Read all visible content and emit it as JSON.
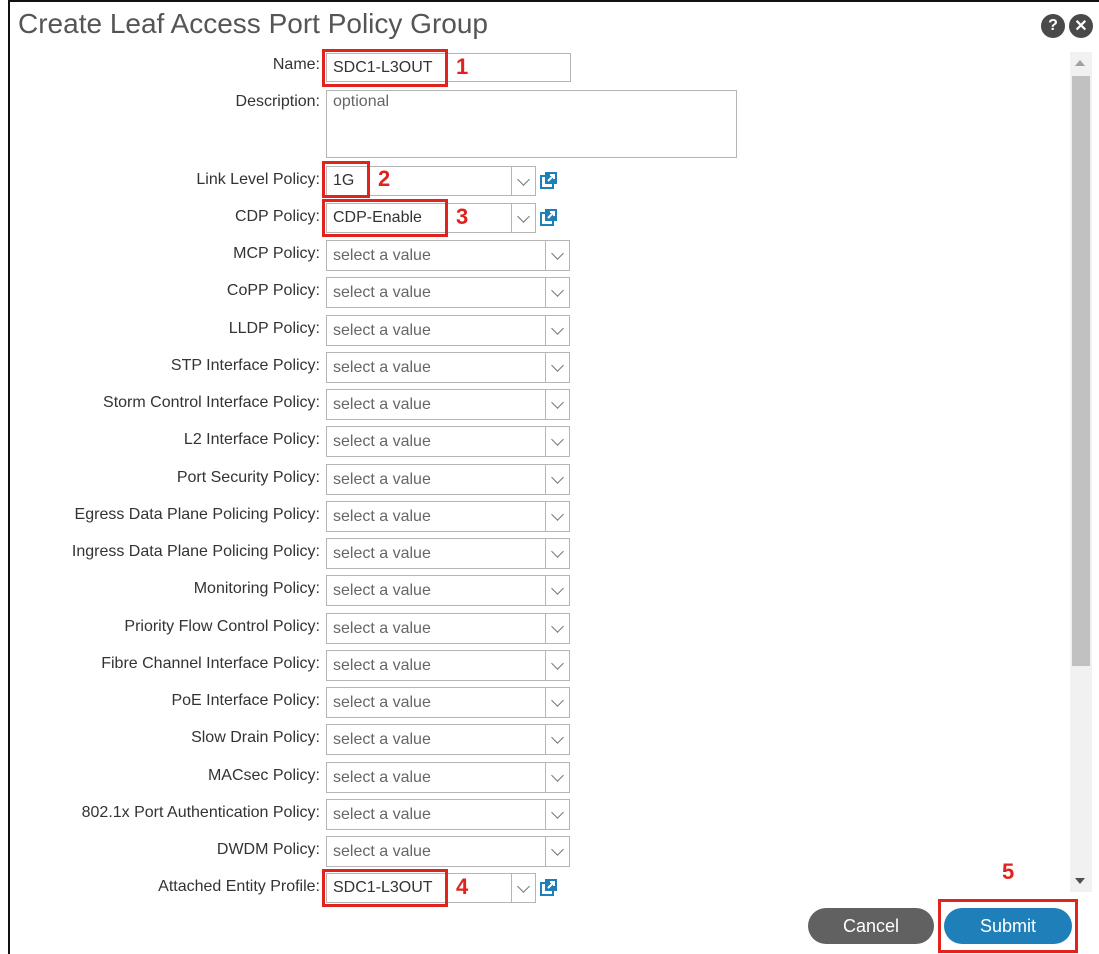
{
  "dialog": {
    "title": "Create Leaf Access Port Policy Group",
    "help_icon": "help-icon",
    "close_icon": "close-icon"
  },
  "fields": {
    "name": {
      "label": "Name:",
      "value": "SDC1-L3OUT"
    },
    "description": {
      "label": "Description:",
      "placeholder": "optional"
    },
    "link_level": {
      "label": "Link Level Policy:",
      "value": "1G"
    },
    "cdp": {
      "label": "CDP Policy:",
      "value": "CDP-Enable"
    },
    "selects": [
      {
        "label": "MCP Policy:",
        "value": "select a value"
      },
      {
        "label": "CoPP Policy:",
        "value": "select a value"
      },
      {
        "label": "LLDP Policy:",
        "value": "select a value"
      },
      {
        "label": "STP Interface Policy:",
        "value": "select a value"
      },
      {
        "label": "Storm Control Interface Policy:",
        "value": "select a value"
      },
      {
        "label": "L2 Interface Policy:",
        "value": "select a value"
      },
      {
        "label": "Port Security Policy:",
        "value": "select a value"
      },
      {
        "label": "Egress Data Plane Policing Policy:",
        "value": "select a value"
      },
      {
        "label": "Ingress Data Plane Policing Policy:",
        "value": "select a value"
      },
      {
        "label": "Monitoring Policy:",
        "value": "select a value"
      },
      {
        "label": "Priority Flow Control Policy:",
        "value": "select a value"
      },
      {
        "label": "Fibre Channel Interface Policy:",
        "value": "select a value"
      },
      {
        "label": "PoE Interface Policy:",
        "value": "select a value"
      },
      {
        "label": "Slow Drain Policy:",
        "value": "select a value"
      },
      {
        "label": "MACsec Policy:",
        "value": "select a value"
      },
      {
        "label": "802.1x Port Authentication Policy:",
        "value": "select a value"
      },
      {
        "label": "DWDM Policy:",
        "value": "select a value"
      }
    ],
    "aep": {
      "label": "Attached Entity Profile:",
      "value": "SDC1-L3OUT"
    }
  },
  "callouts": [
    "1",
    "2",
    "3",
    "4",
    "5"
  ],
  "buttons": {
    "cancel": "Cancel",
    "submit": "Submit"
  },
  "colors": {
    "accent": "#1f7fb9",
    "callout": "#e0231c",
    "cancel": "#616161"
  }
}
